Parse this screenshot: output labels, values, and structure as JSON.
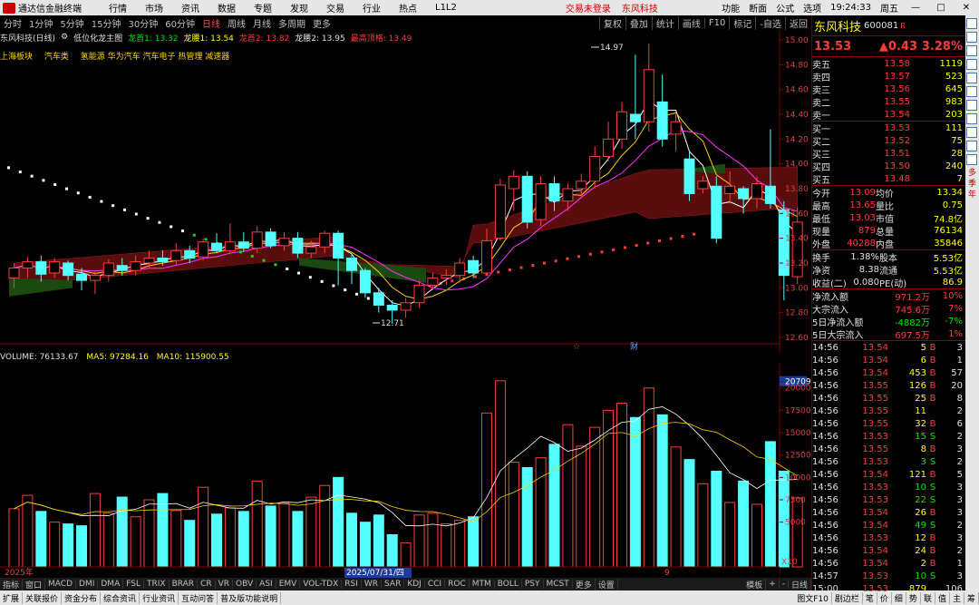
{
  "titlebar": {
    "app_name": "通达信金融终端",
    "menu": [
      "行情",
      "市场",
      "资讯",
      "数据",
      "专题",
      "发现",
      "交易",
      "行业",
      "热点",
      "L1L2"
    ],
    "login_status": "交易未登录",
    "broker": "东风科技",
    "right_menu": [
      "功能",
      "断面",
      "公式",
      "选项"
    ],
    "clock": "19:24:33",
    "weekday": "周五"
  },
  "periods": [
    "分时",
    "1分钟",
    "5分钟",
    "15分钟",
    "30分钟",
    "60分钟",
    "日线",
    "周线",
    "月线",
    "多周期",
    "更多"
  ],
  "active_period": "日线",
  "tools": [
    "复权",
    "叠加",
    "统计",
    "画线",
    "F10",
    "标记",
    "-自选",
    "返回"
  ],
  "chart_info": {
    "name": "东风科技(日线)",
    "indicator": "低位化龙主图",
    "l1": "龙首1: 13.32",
    "l2": "龙腰1: 13.54",
    "l3": "龙首2: 13.82",
    "l4": "龙腰2: 13.95",
    "l5": "最高顶格: 13.49"
  },
  "sectors": [
    "上海板块",
    "汽车类",
    "氢能源 华为汽车 汽车电子 热管理 减速器"
  ],
  "price_axis": [
    "15.00",
    "14.80",
    "14.60",
    "14.40",
    "14.20",
    "14.00",
    "13.80",
    "13.60",
    "13.40",
    "13.20",
    "13.00",
    "12.80",
    "12.60"
  ],
  "annotations": {
    "high": "14.97",
    "low": "12.71",
    "bottom_marks": [
      "☆",
      "财"
    ]
  },
  "volume_info": {
    "vol": "VOLUME: 76133.67",
    "ma5": "MA5: 97284.16",
    "ma10": "MA10: 115900.55"
  },
  "vol_axis": [
    "20709",
    "20000",
    "17500",
    "15000",
    "12500",
    "10000",
    "7500",
    "5000",
    "X10"
  ],
  "timeline": {
    "left": "2025年",
    "date": "2025/07/31/四",
    "mark": "9"
  },
  "indicators": [
    "指标",
    "窗口",
    "MACD",
    "DMI",
    "DMA",
    "FSL",
    "TRIX",
    "BRAR",
    "CR",
    "VR",
    "OBV",
    "ASI",
    "EMV",
    "VOL-TDX",
    "RSI",
    "WR",
    "SAR",
    "KDJ",
    "CCI",
    "ROC",
    "MTM",
    "BOLL",
    "PSY",
    "MCST",
    "更多",
    "设置"
  ],
  "indicator_right": [
    "模板",
    "+",
    "-",
    "日线"
  ],
  "bottom_tabs": [
    "扩展",
    "关联报价",
    "资金分布",
    "综合资讯",
    "行业资讯",
    "互动问答",
    "普及版功能说明"
  ],
  "bottom_right": [
    "图文F10",
    "剧边栏",
    "笔",
    "价",
    "细",
    "势",
    "联",
    "值",
    "主",
    "筹"
  ],
  "quote": {
    "name": "东风科技",
    "code": "600081",
    "flag": "R",
    "price": "13.53",
    "change": "▲0.43",
    "pct": "3.28%"
  },
  "asks": [
    {
      "l": "卖五",
      "p": "13.58",
      "v": "1119"
    },
    {
      "l": "卖四",
      "p": "13.57",
      "v": "523"
    },
    {
      "l": "卖三",
      "p": "13.56",
      "v": "645"
    },
    {
      "l": "卖二",
      "p": "13.55",
      "v": "983"
    },
    {
      "l": "卖一",
      "p": "13.54",
      "v": "203"
    }
  ],
  "bids": [
    {
      "l": "买一",
      "p": "13.53",
      "v": "111"
    },
    {
      "l": "买二",
      "p": "13.52",
      "v": "75"
    },
    {
      "l": "买三",
      "p": "13.51",
      "v": "28"
    },
    {
      "l": "买四",
      "p": "13.50",
      "v": "240"
    },
    {
      "l": "买五",
      "p": "13.48",
      "v": "7"
    }
  ],
  "stats": [
    {
      "a": "今开",
      "av": "13.09",
      "b": "均价",
      "bv": "13.34"
    },
    {
      "a": "最高",
      "av": "13.65",
      "b": "量比",
      "bv": "0.75"
    },
    {
      "a": "最低",
      "av": "13.03",
      "b": "市值",
      "bv": "74.8亿"
    },
    {
      "a": "现量",
      "av": "879",
      "b": "总量",
      "bv": "76134"
    },
    {
      "a": "外盘",
      "av": "40288",
      "b": "内盘",
      "bv": "35846"
    }
  ],
  "stats2": [
    {
      "a": "换手",
      "av": "1.38%",
      "b": "股本",
      "bv": "5.53亿"
    },
    {
      "a": "净资",
      "av": "8.38",
      "b": "流通",
      "bv": "5.53亿"
    },
    {
      "a": "收益(二)",
      "av": "0.080",
      "b": "PE(动)",
      "bv": "86.9"
    }
  ],
  "flows": [
    {
      "l": "净流入额",
      "v": "971.2万",
      "p": "10%"
    },
    {
      "l": "大宗流入",
      "v": "745.6万",
      "p": "7%"
    },
    {
      "l": "5日净流入额",
      "v": "-4882万",
      "p": "-7%"
    },
    {
      "l": "5日大宗流入",
      "v": "697.5万",
      "p": "1%"
    }
  ],
  "ticks": [
    {
      "t": "14:56",
      "p": "13.54",
      "v": "5",
      "d": "B",
      "n": "3"
    },
    {
      "t": "14:56",
      "p": "13.54",
      "v": "6",
      "d": "B",
      "n": "1"
    },
    {
      "t": "14:56",
      "p": "13.54",
      "v": "453",
      "d": "B",
      "n": "57"
    },
    {
      "t": "14:56",
      "p": "13.55",
      "v": "126",
      "d": "B",
      "n": "20"
    },
    {
      "t": "14:56",
      "p": "13.55",
      "v": "25",
      "d": "B",
      "n": "8"
    },
    {
      "t": "14:56",
      "p": "13.55",
      "v": "11",
      "d": "",
      "n": "2"
    },
    {
      "t": "14:56",
      "p": "13.55",
      "v": "32",
      "d": "B",
      "n": "6"
    },
    {
      "t": "14:56",
      "p": "13.53",
      "v": "15",
      "d": "S",
      "n": "2"
    },
    {
      "t": "14:56",
      "p": "13.55",
      "v": "8",
      "d": "B",
      "n": "3"
    },
    {
      "t": "14:56",
      "p": "13.53",
      "v": "3",
      "d": "S",
      "n": "2"
    },
    {
      "t": "14:56",
      "p": "13.54",
      "v": "121",
      "d": "B",
      "n": "5"
    },
    {
      "t": "14:56",
      "p": "13.53",
      "v": "10",
      "d": "S",
      "n": "3"
    },
    {
      "t": "14:56",
      "p": "13.53",
      "v": "22",
      "d": "S",
      "n": "3"
    },
    {
      "t": "14:56",
      "p": "13.54",
      "v": "26",
      "d": "B",
      "n": "3"
    },
    {
      "t": "14:56",
      "p": "13.54",
      "v": "49",
      "d": "S",
      "n": "2"
    },
    {
      "t": "14:56",
      "p": "13.53",
      "v": "12",
      "d": "B",
      "n": "3"
    },
    {
      "t": "14:56",
      "p": "13.54",
      "v": "24",
      "d": "B",
      "n": "2"
    },
    {
      "t": "14:56",
      "p": "13.54",
      "v": "2",
      "d": "B",
      "n": "1"
    },
    {
      "t": "14:57",
      "p": "13.53",
      "v": "10",
      "d": "S",
      "n": "3"
    },
    {
      "t": "15:00",
      "p": "13.53",
      "v": "879",
      "d": "",
      "n": "106"
    }
  ],
  "side_icons": [
    "行情",
    "新闻",
    "分时",
    "K线",
    "F10",
    "资金",
    "龙虎",
    "财务",
    "股东",
    "研报",
    "公告",
    "多",
    "季",
    "年"
  ]
}
